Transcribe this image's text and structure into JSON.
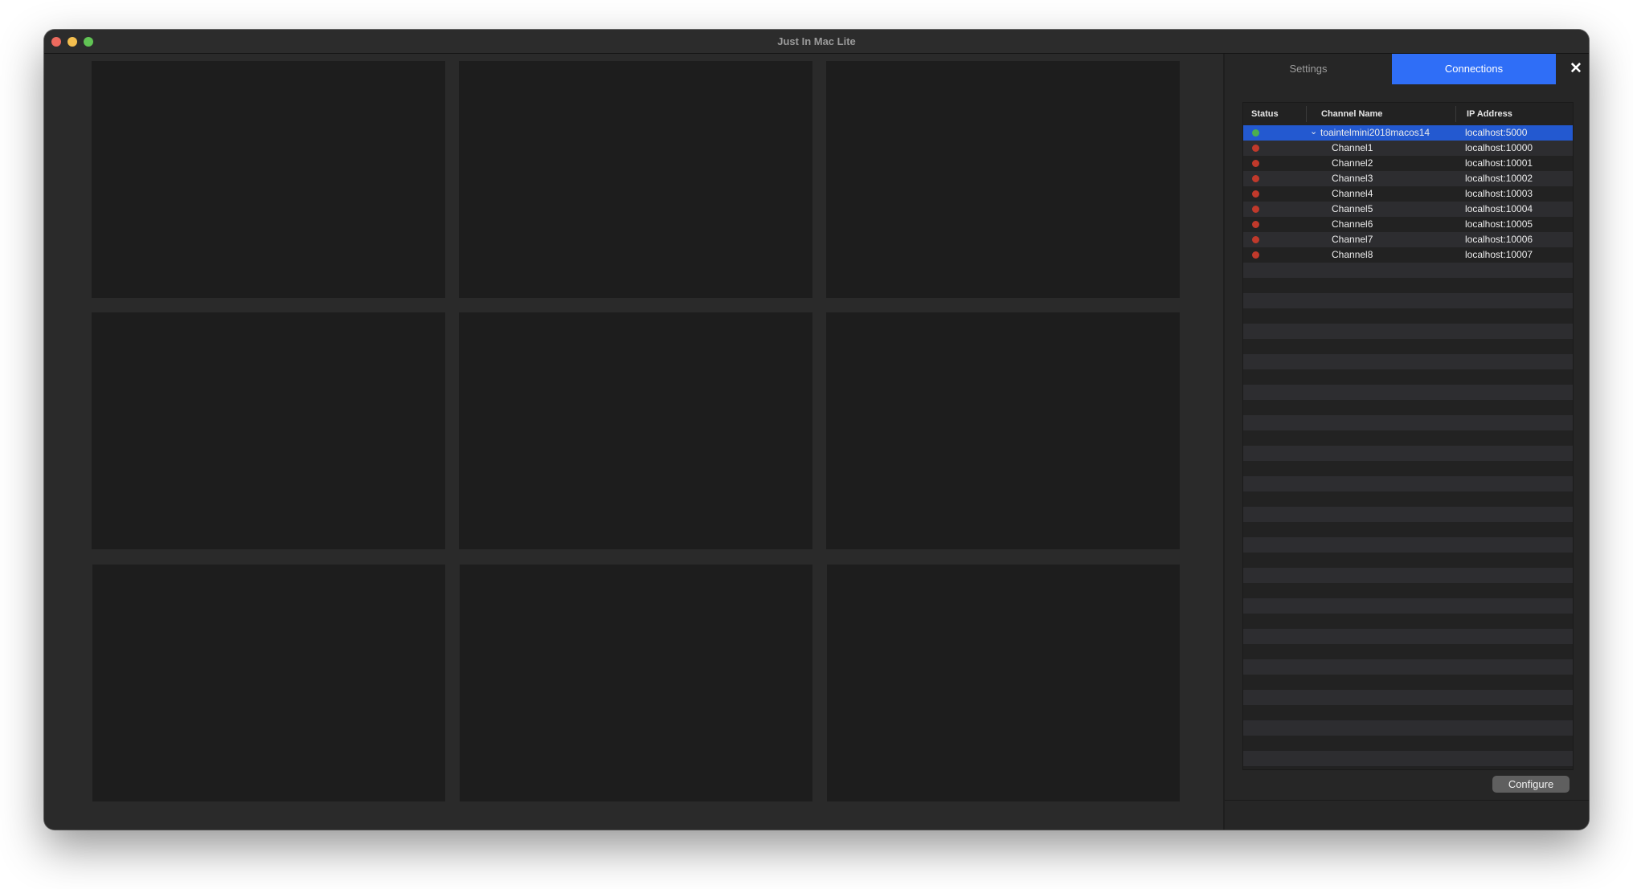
{
  "window": {
    "title": "Just In Mac Lite"
  },
  "tabs": [
    {
      "label": "Settings",
      "active": false
    },
    {
      "label": "Connections",
      "active": true
    }
  ],
  "connections": {
    "columns": {
      "status": "Status",
      "channel_name": "Channel Name",
      "ip_address": "IP Address"
    },
    "rows": [
      {
        "status": "green",
        "name": "toaintelmini2018macos14",
        "ip": "localhost:5000",
        "expanded": true,
        "selected": true
      },
      {
        "status": "red",
        "name": "Channel1",
        "ip": "localhost:10000"
      },
      {
        "status": "red",
        "name": "Channel2",
        "ip": "localhost:10001"
      },
      {
        "status": "red",
        "name": "Channel3",
        "ip": "localhost:10002"
      },
      {
        "status": "red",
        "name": "Channel4",
        "ip": "localhost:10003"
      },
      {
        "status": "red",
        "name": "Channel5",
        "ip": "localhost:10004"
      },
      {
        "status": "red",
        "name": "Channel6",
        "ip": "localhost:10005"
      },
      {
        "status": "red",
        "name": "Channel7",
        "ip": "localhost:10006"
      },
      {
        "status": "red",
        "name": "Channel8",
        "ip": "localhost:10007"
      }
    ]
  },
  "configure_label": "Configure",
  "colors": {
    "accent": "#2f6ef7",
    "selection": "#2359d0",
    "status_green": "#4caf50",
    "status_red": "#c0392b"
  },
  "icons": {
    "close": "close-icon",
    "expand": "chevron-down-icon"
  }
}
